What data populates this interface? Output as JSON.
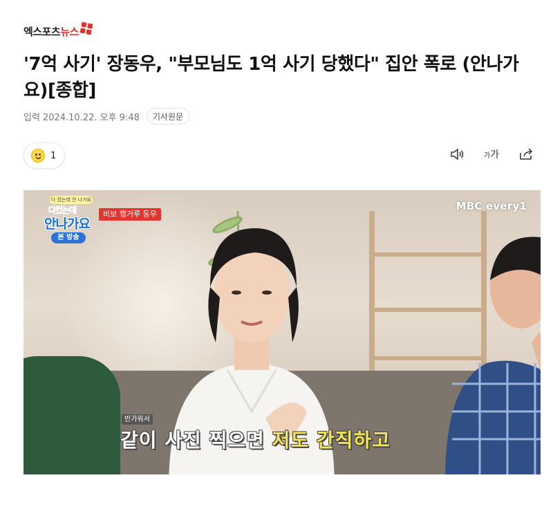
{
  "header": {
    "logo_text_main": "엑스포츠",
    "logo_text_accent": "뉴스"
  },
  "article": {
    "headline": "'7억 사기' 장동우, \"부모님도 1억 사기 당했다\" 집안 폭로 (안나가요)[종합]",
    "meta_label": "입력",
    "meta_date": "2024.10.22. 오후 9:48",
    "original_label": "기사원문"
  },
  "reaction": {
    "icon": "smile-icon",
    "count": "1"
  },
  "tools": {
    "audio_icon": "speaker-icon",
    "fontsize_label_small": "가",
    "fontsize_label_large": "가",
    "share_icon": "share-icon"
  },
  "video": {
    "show_top": "다 컸는데 안 나가요",
    "show_title_1": "다컸는데",
    "show_title_2": "안나가요",
    "show_badge": "본 방송",
    "name_tag": "비보 캥거루 동우",
    "channel": "MBC every1",
    "sub_tag": "반가워서",
    "subtitle_main": "같이 사진 찍으면 ",
    "subtitle_highlight": "저도 간직하고"
  },
  "colors": {
    "brand_red": "#e0322a",
    "show_blue": "#1c6ed8",
    "subtitle_yellow": "#f3e35a"
  }
}
